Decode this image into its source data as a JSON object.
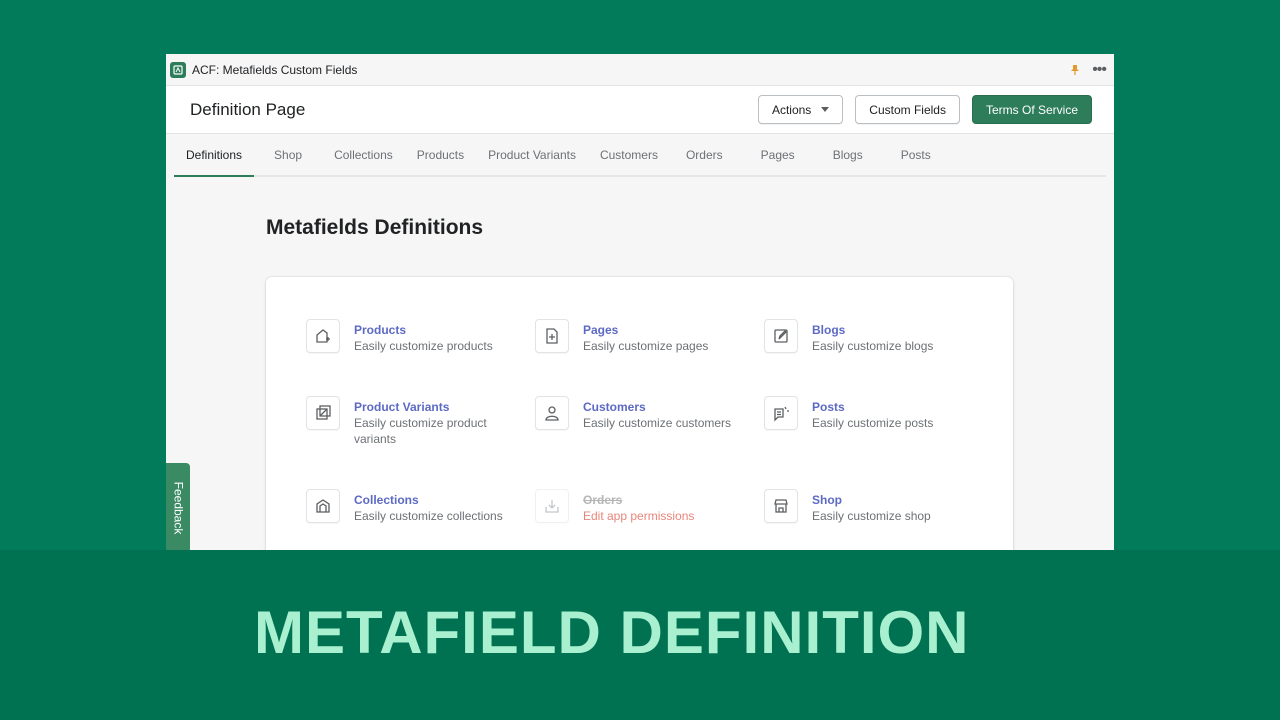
{
  "app": {
    "title": "ACF: Metafields Custom Fields",
    "icons": [
      "app-logo-icon",
      "pin-icon",
      "more-icon"
    ]
  },
  "header": {
    "title": "Definition Page",
    "actions_label": "Actions",
    "custom_fields_label": "Custom Fields",
    "terms_label": "Terms Of Service"
  },
  "tabs": [
    {
      "label": "Definitions",
      "active": true
    },
    {
      "label": "Shop"
    },
    {
      "label": "Collections"
    },
    {
      "label": "Products"
    },
    {
      "label": "Product Variants"
    },
    {
      "label": "Customers"
    },
    {
      "label": "Orders"
    },
    {
      "label": "Pages"
    },
    {
      "label": "Blogs"
    },
    {
      "label": "Posts"
    }
  ],
  "section": {
    "title": "Metafields Definitions"
  },
  "items": [
    {
      "title": "Products",
      "desc": "Easily customize products",
      "icon": "product-icon"
    },
    {
      "title": "Pages",
      "desc": "Easily customize pages",
      "icon": "page-icon"
    },
    {
      "title": "Blogs",
      "desc": "Easily customize blogs",
      "icon": "blog-icon"
    },
    {
      "title": "Product Variants",
      "desc": "Easily customize product variants",
      "icon": "variant-icon"
    },
    {
      "title": "Customers",
      "desc": "Easily customize customers",
      "icon": "customer-icon"
    },
    {
      "title": "Posts",
      "desc": "Easily customize posts",
      "icon": "post-icon"
    },
    {
      "title": "Collections",
      "desc": "Easily customize collections",
      "icon": "collection-icon"
    },
    {
      "title": "Orders",
      "desc": "Edit app permissions",
      "icon": "order-icon",
      "disabled": true
    },
    {
      "title": "Shop",
      "desc": "Easily customize shop",
      "icon": "shop-icon"
    }
  ],
  "feedback_label": "Feedback",
  "banner": {
    "text": "METAFIELD DEFINITION"
  },
  "colors": {
    "accent": "#2e7d5a",
    "link": "#5c6ac4",
    "background": "#017b5a",
    "banner": "#007252",
    "banner_text": "#a8f0cf"
  }
}
